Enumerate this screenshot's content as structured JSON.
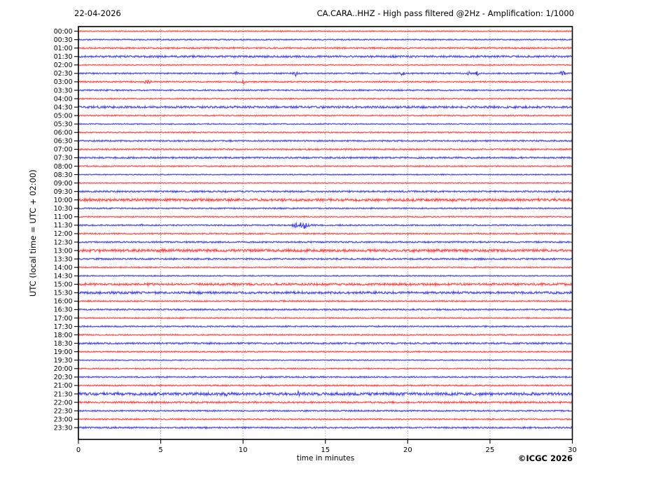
{
  "header": {
    "date": "22-04-2026",
    "title": "CA.CARA..HHZ - High pass filtered @2Hz - Amplification: 1/1000"
  },
  "axes": {
    "y_label": "UTC (local time = UTC + 02:00)",
    "x_label": "time in minutes"
  },
  "footer": {
    "copyright": "©ICGC 2026"
  },
  "colors": {
    "trace_red": "#ff2a2a",
    "trace_blue": "#2a2ad8",
    "grid": "#777777",
    "spine": "#000000",
    "background": "#ffffff"
  },
  "chart_data": {
    "type": "line",
    "subtype": "helicorder-day-plot",
    "station": "CA.CARA..HHZ",
    "filter": "High pass filtered @2Hz",
    "amplification": "1/1000",
    "date": "22-04-2026",
    "x_range_minutes": [
      0,
      30
    ],
    "x_ticks": [
      0,
      5,
      10,
      15,
      20,
      25,
      30
    ],
    "grid_minutes": [
      5,
      10,
      15,
      20,
      25
    ],
    "minutes_per_row": 30,
    "rows": [
      {
        "label": "00:00",
        "color": "red",
        "noise": 0.6
      },
      {
        "label": "00:30",
        "color": "blue",
        "noise": 0.7
      },
      {
        "label": "01:00",
        "color": "red",
        "noise": 0.9
      },
      {
        "label": "01:30",
        "color": "blue",
        "noise": 1.2
      },
      {
        "label": "02:00",
        "color": "red",
        "noise": 0.6
      },
      {
        "label": "02:30",
        "color": "blue",
        "noise": 0.8
      },
      {
        "label": "03:00",
        "color": "red",
        "noise": 0.8
      },
      {
        "label": "03:30",
        "color": "blue",
        "noise": 0.8
      },
      {
        "label": "04:00",
        "color": "red",
        "noise": 0.7
      },
      {
        "label": "04:30",
        "color": "blue",
        "noise": 1.3
      },
      {
        "label": "05:00",
        "color": "red",
        "noise": 0.7
      },
      {
        "label": "05:30",
        "color": "blue",
        "noise": 0.6
      },
      {
        "label": "06:00",
        "color": "red",
        "noise": 0.7
      },
      {
        "label": "06:30",
        "color": "blue",
        "noise": 0.9
      },
      {
        "label": "07:00",
        "color": "red",
        "noise": 0.9
      },
      {
        "label": "07:30",
        "color": "blue",
        "noise": 1.0
      },
      {
        "label": "08:00",
        "color": "red",
        "noise": 0.7
      },
      {
        "label": "08:30",
        "color": "blue",
        "noise": 0.6
      },
      {
        "label": "09:00",
        "color": "red",
        "noise": 0.6
      },
      {
        "label": "09:30",
        "color": "blue",
        "noise": 1.0
      },
      {
        "label": "10:00",
        "color": "red",
        "noise": 1.7
      },
      {
        "label": "10:30",
        "color": "blue",
        "noise": 0.8
      },
      {
        "label": "11:00",
        "color": "red",
        "noise": 0.7
      },
      {
        "label": "11:30",
        "color": "blue",
        "noise": 0.8
      },
      {
        "label": "12:00",
        "color": "red",
        "noise": 0.8
      },
      {
        "label": "12:30",
        "color": "blue",
        "noise": 0.9
      },
      {
        "label": "13:00",
        "color": "red",
        "noise": 1.7
      },
      {
        "label": "13:30",
        "color": "blue",
        "noise": 1.0
      },
      {
        "label": "14:00",
        "color": "red",
        "noise": 0.7
      },
      {
        "label": "14:30",
        "color": "blue",
        "noise": 0.6
      },
      {
        "label": "15:00",
        "color": "red",
        "noise": 1.4
      },
      {
        "label": "15:30",
        "color": "blue",
        "noise": 1.5
      },
      {
        "label": "16:00",
        "color": "red",
        "noise": 0.8
      },
      {
        "label": "16:30",
        "color": "blue",
        "noise": 0.9
      },
      {
        "label": "17:00",
        "color": "red",
        "noise": 0.7
      },
      {
        "label": "17:30",
        "color": "blue",
        "noise": 0.8
      },
      {
        "label": "18:00",
        "color": "red",
        "noise": 0.7
      },
      {
        "label": "18:30",
        "color": "blue",
        "noise": 1.1
      },
      {
        "label": "19:00",
        "color": "red",
        "noise": 0.7
      },
      {
        "label": "19:30",
        "color": "blue",
        "noise": 0.6
      },
      {
        "label": "20:00",
        "color": "red",
        "noise": 0.7
      },
      {
        "label": "20:30",
        "color": "blue",
        "noise": 0.8
      },
      {
        "label": "21:00",
        "color": "red",
        "noise": 0.8
      },
      {
        "label": "21:30",
        "color": "blue",
        "noise": 1.8
      },
      {
        "label": "22:00",
        "color": "red",
        "noise": 1.1
      },
      {
        "label": "22:30",
        "color": "blue",
        "noise": 0.8
      },
      {
        "label": "23:00",
        "color": "red",
        "noise": 0.8
      },
      {
        "label": "23:30",
        "color": "blue",
        "noise": 0.9
      }
    ],
    "events": [
      {
        "row": "02:30",
        "minute": 9.6,
        "amplitude": 2.5,
        "width": 0.06
      },
      {
        "row": "02:30",
        "minute": 13.2,
        "amplitude": 3.2,
        "width": 0.07
      },
      {
        "row": "02:30",
        "minute": 19.7,
        "amplitude": 2.4,
        "width": 0.1
      },
      {
        "row": "02:30",
        "minute": 23.7,
        "amplitude": 2.0,
        "width": 0.05
      },
      {
        "row": "02:30",
        "minute": 24.2,
        "amplitude": 2.6,
        "width": 0.07
      },
      {
        "row": "02:30",
        "minute": 29.4,
        "amplitude": 3.2,
        "width": 0.1
      },
      {
        "row": "03:00",
        "minute": 4.2,
        "amplitude": 2.0,
        "width": 0.15
      },
      {
        "row": "03:00",
        "minute": 10.05,
        "amplitude": 2.6,
        "width": 0.06
      },
      {
        "row": "11:30",
        "minute": 3.9,
        "amplitude": 1.4,
        "width": 0.05
      },
      {
        "row": "11:30",
        "minute": 13.2,
        "amplitude": 2.2,
        "width": 0.15
      },
      {
        "row": "11:30",
        "minute": 13.7,
        "amplitude": 4.5,
        "width": 0.22
      },
      {
        "row": "20:30",
        "minute": 11.05,
        "amplitude": 1.6,
        "width": 0.05
      },
      {
        "row": "21:30",
        "minute": 9.0,
        "amplitude": 1.8,
        "width": 0.06
      },
      {
        "row": "21:30",
        "minute": 13.4,
        "amplitude": 2.6,
        "width": 0.08
      }
    ]
  }
}
